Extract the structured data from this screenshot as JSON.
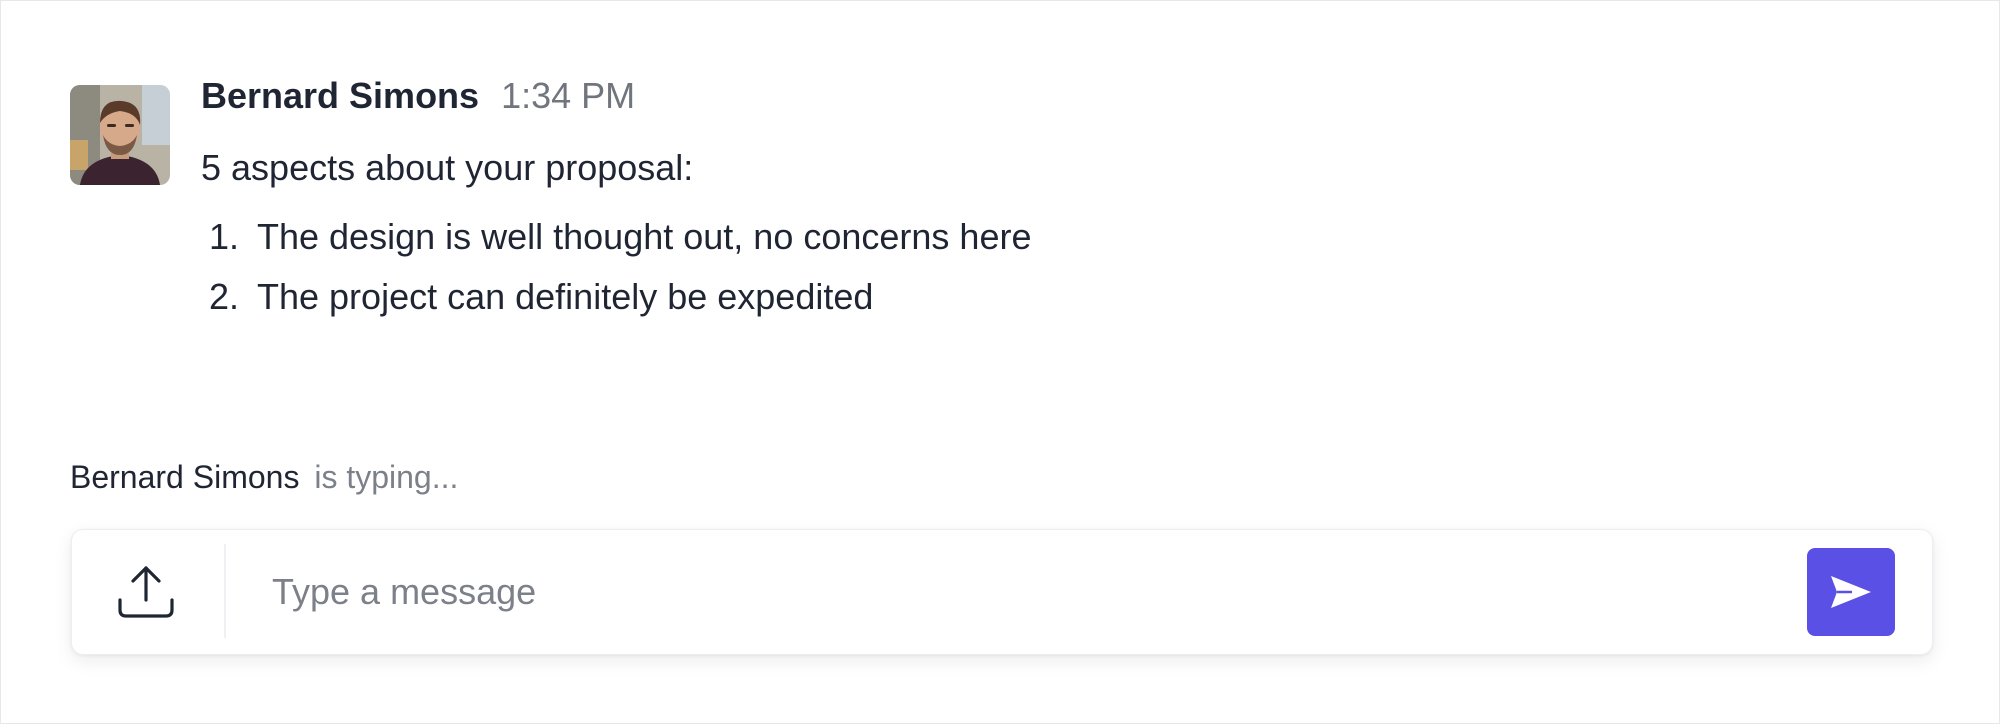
{
  "theme": {
    "accent": "#5b50e6",
    "text": "#1f2533",
    "muted": "#70757e"
  },
  "message": {
    "avatar_icon": "person-avatar",
    "author": "Bernard Simons",
    "time": "1:34 PM",
    "intro": "5 aspects about your proposal:",
    "items": [
      {
        "num": "1.",
        "text": "The design is well thought out, no concerns here"
      },
      {
        "num": "2.",
        "text": "The project can definitely be expedited"
      }
    ]
  },
  "typing": {
    "who": "Bernard Simons",
    "status": "is typing..."
  },
  "composer": {
    "upload_icon": "upload-icon",
    "placeholder": "Type a message",
    "value": "",
    "send_icon": "send-icon"
  }
}
